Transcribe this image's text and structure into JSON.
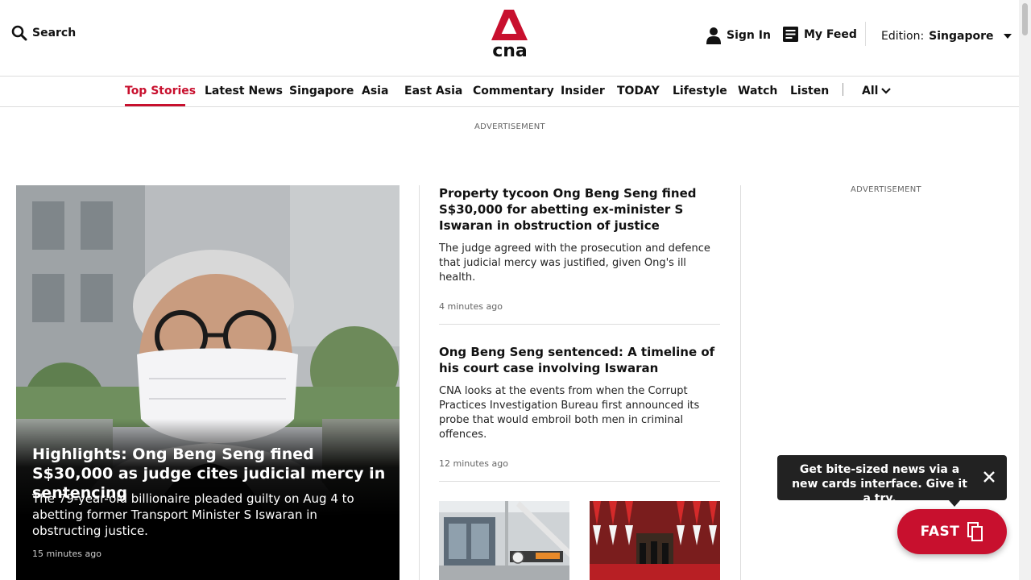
{
  "header": {
    "search_label": "Search",
    "logo_text": "cna",
    "signin_label": "Sign In",
    "myfeed_label": "My Feed",
    "edition_label": "Edition:",
    "edition_value": "Singapore",
    "brand_color": "#c8102e"
  },
  "nav": {
    "items": [
      {
        "label": "Top Stories",
        "active": true
      },
      {
        "label": "Latest News"
      },
      {
        "label": "Singapore"
      },
      {
        "label": "Asia"
      },
      {
        "label": "East Asia"
      },
      {
        "label": "Commentary"
      },
      {
        "label": "Insider"
      },
      {
        "label": "TODAY"
      },
      {
        "label": "Lifestyle"
      },
      {
        "label": "Watch"
      },
      {
        "label": "Listen"
      }
    ],
    "all_label": "All"
  },
  "ads": {
    "top_label": "ADVERTISEMENT",
    "side_label": "ADVERTISEMENT"
  },
  "hero": {
    "title": "Highlights: Ong Beng Seng fined S$30,000 as judge cites judicial mercy in sentencing",
    "description": "The 79-year-old billionaire pleaded guilty on Aug 4 to abetting former Transport Minister S Iswaran in obstructing justice.",
    "time": "15 minutes ago"
  },
  "stories": [
    {
      "title": "Property tycoon Ong Beng Seng fined S$30,000 for abetting ex-minister S Iswaran in obstruction of justice",
      "description": "The judge agreed with the prosecution and defence that judicial mercy was justified, given Ong's ill health.",
      "time": "4 minutes ago"
    },
    {
      "title": "Ong Beng Seng sentenced: A timeline of his court case involving Iswaran",
      "description": "CNA looks at the events from when the Corrupt Practices Investigation Bureau first announced its probe that would embroil both men in criminal offences.",
      "time": "12 minutes ago"
    }
  ],
  "fast": {
    "tooltip": "Get bite-sized news via a new cards interface. Give it a try.",
    "button_label": "FAST"
  }
}
